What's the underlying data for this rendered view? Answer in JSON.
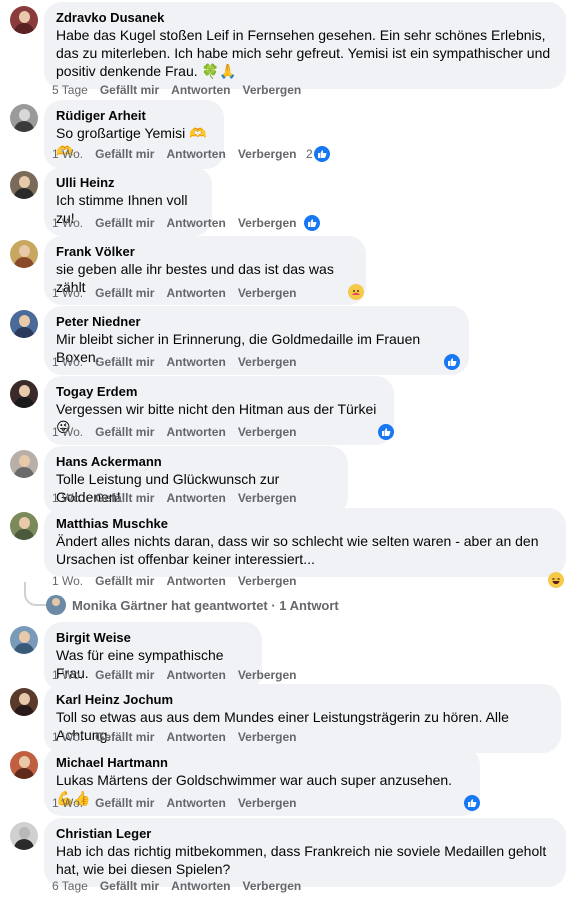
{
  "colors": {
    "like_blue": "#1877f2",
    "bubble": "#f0f2f5",
    "meta": "#65676b"
  },
  "actions": {
    "like": "Gefällt mir",
    "reply": "Antworten",
    "hide": "Verbergen"
  },
  "comments": [
    {
      "author": "Zdravko Dusanek",
      "text": "Habe das Kugel stoßen Leif in Fernsehen gesehen. Ein sehr schönes Erlebnis, das zu miterleben. Ich habe mich sehr gefreut. Yemisi ist ein sympathischer und positiv denkende Frau. 🍀🙏",
      "time": "5 Tage",
      "reactions": null
    },
    {
      "author": "Rüdiger Arheit",
      "text": "So großartige Yemisi 🫶🫶",
      "time": "1 Wo.",
      "reactions": {
        "type": "like",
        "count": "2"
      }
    },
    {
      "author": "Ulli Heinz",
      "text": "Ich stimme Ihnen voll zu!",
      "time": "1 Wo.",
      "reactions": {
        "type": "like",
        "count": ""
      }
    },
    {
      "author": "Frank Völker",
      "text": "sie geben alle ihr bestes und das ist das was zählt",
      "time": "1 Wo.",
      "reactions": {
        "type": "care",
        "count": ""
      }
    },
    {
      "author": "Peter Niedner",
      "text": "Mir bleibt sicher in Erinnerung, die Goldmedaille im Frauen Boxen.",
      "time": "1 Wo.",
      "reactions": {
        "type": "like",
        "count": ""
      }
    },
    {
      "author": "Togay Erdem",
      "text": "Vergessen wir bitte nicht den Hitman aus der Türkei 😜",
      "time": "1 Wo.",
      "reactions": {
        "type": "like",
        "count": ""
      }
    },
    {
      "author": "Hans Ackermann",
      "text": "Tolle Leistung und Glückwunsch zur Goldenen!",
      "time": "1 Wo.",
      "reactions": null
    },
    {
      "author": "Matthias Muschke",
      "text": "Ändert alles nichts daran, dass wir so schlecht wie selten waren - aber an den Ursachen ist offenbar keiner interessiert...",
      "time": "1 Wo.",
      "reactions": {
        "type": "haha",
        "count": ""
      }
    },
    {
      "author": "Birgit Weise",
      "text": "Was für eine sympathische Frau.",
      "time": "1 Wo.",
      "reactions": null
    },
    {
      "author": "Karl Heinz Jochum",
      "text": "Toll so etwas aus aus dem Mundes einer Leistungsträgerin zu hören. Alle Achtung.",
      "time": "1 Wo.",
      "reactions": null
    },
    {
      "author": "Michael Hartmann",
      "text": "Lukas Märtens der Goldschwimmer war auch super anzusehen. 💪👍",
      "time": "1 Wo.",
      "reactions": {
        "type": "like",
        "count": ""
      }
    },
    {
      "author": "Christian Leger",
      "text": "Hab ich das richtig mitbekommen, dass Frankreich nie soviele Medaillen geholt hat, wie bei diesen Spielen?",
      "time": "6 Tage",
      "reactions": null
    }
  ],
  "reply_thread": {
    "text": "Monika Gärtner hat geantwortet · 1 Antwort"
  }
}
